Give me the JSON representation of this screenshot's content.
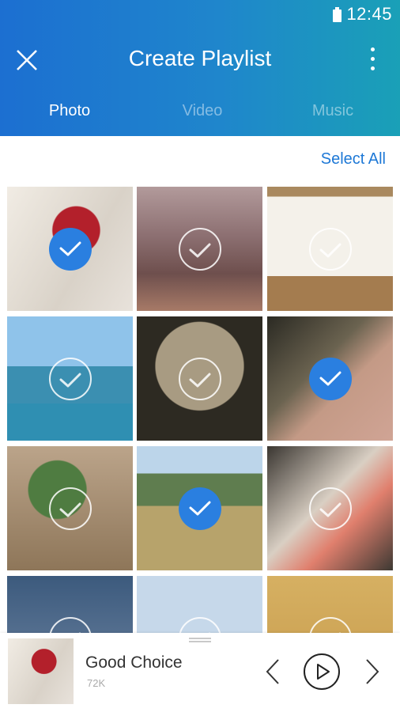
{
  "status": {
    "time": "12:45",
    "battery_icon": "battery-full-icon"
  },
  "header": {
    "title": "Create Playlist",
    "close_icon": "close-icon",
    "more_icon": "more-vert-icon"
  },
  "tabs": [
    {
      "label": "Photo",
      "active": true
    },
    {
      "label": "Video",
      "active": false
    },
    {
      "label": "Music",
      "active": false
    }
  ],
  "select_all_label": "Select All",
  "photos": [
    {
      "selected": true
    },
    {
      "selected": false
    },
    {
      "selected": false
    },
    {
      "selected": false
    },
    {
      "selected": false
    },
    {
      "selected": true
    },
    {
      "selected": false
    },
    {
      "selected": true
    },
    {
      "selected": false
    },
    {
      "selected": false
    },
    {
      "selected": false
    },
    {
      "selected": false
    }
  ],
  "player": {
    "song": "Good Choice",
    "size": "72K",
    "prev_icon": "chevron-left-icon",
    "play_icon": "play-icon",
    "next_icon": "chevron-right-icon"
  },
  "colors": {
    "accent": "#2a7fe0",
    "header_start": "#1c6fd1",
    "header_end": "#1aa0b7"
  }
}
